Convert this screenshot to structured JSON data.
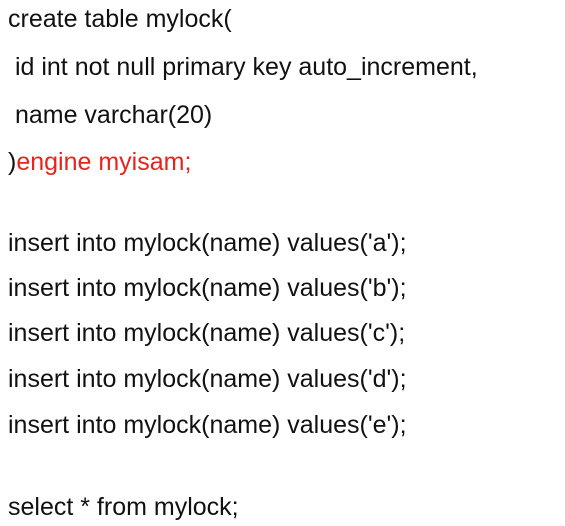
{
  "code": {
    "create_open": "create table mylock(",
    "col_id": " id int not null primary key auto_increment,",
    "col_name": " name varchar(20)",
    "close_paren": ")",
    "engine_clause": "engine myisam;",
    "inserts": [
      "insert into mylock(name) values('a');",
      "insert into mylock(name) values('b');",
      "insert into mylock(name) values('c');",
      "insert into mylock(name) values('d');",
      "insert into mylock(name) values('e');"
    ],
    "select_stmt": "select * from mylock;"
  },
  "colors": {
    "text": "#111111",
    "highlight": "#e8231f",
    "background": "#ffffff"
  }
}
